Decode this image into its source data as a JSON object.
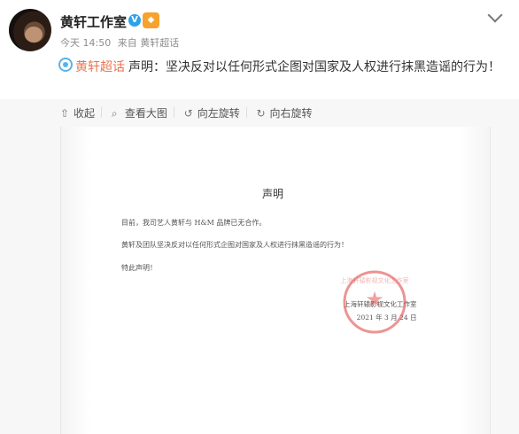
{
  "post": {
    "author": "黄轩工作室",
    "verified_icon": "verified-v-icon",
    "vip_icon": "vip-badge-icon",
    "time": "今天 14:50",
    "source": "来自 黄轩超话",
    "topic": "黄轩超话",
    "text": "声明：坚决反对以任何形式企图对国家及人权进行抹黑造谣的行为！",
    "menu_icon": "chevron-down-icon"
  },
  "toolbar": {
    "collapse": "收起",
    "view_large": "查看大图",
    "rotate_left": "向左旋转",
    "rotate_right": "向右旋转"
  },
  "document": {
    "title": "声明",
    "line1": "目前，我司艺人黄轩与 H&M 品牌已无合作。",
    "line2": "黄轩及团队坚决反对以任何形式企图对国家及人权进行抹黑造谣的行为！",
    "line3": "特此声明！",
    "studio": "上海轩辕影视文化工作室",
    "date": "2021 年 3 月 24 日",
    "seal_text": "上海轩辕影视文化工作室"
  }
}
